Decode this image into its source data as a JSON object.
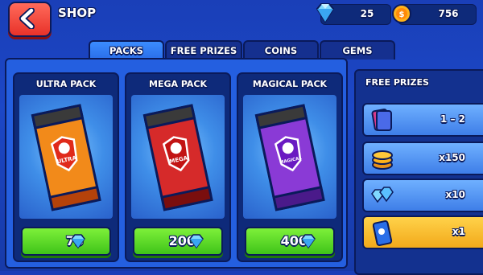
{
  "header": {
    "title": "SHOP",
    "gems": "25",
    "coins": "756"
  },
  "tabs": [
    {
      "label": "PACKS",
      "active": true
    },
    {
      "label": "FREE PRIZES",
      "active": false
    },
    {
      "label": "COINS",
      "active": false
    },
    {
      "label": "GEMS",
      "active": false
    }
  ],
  "packs": [
    {
      "title": "ULTRA PACK",
      "badge": "ULTRA",
      "price": "75",
      "color": "#f28a1a"
    },
    {
      "title": "MEGA PACK",
      "badge": "MEGA",
      "price": "200",
      "color": "#d62a2a"
    },
    {
      "title": "MAGICAL PACK",
      "badge": "MAGICAL",
      "price": "400",
      "color": "#8a3ad6"
    }
  ],
  "free_prizes": {
    "title": "FREE PRIZES",
    "items": [
      {
        "amount": "1 – 2",
        "icon": "cards-icon"
      },
      {
        "amount": "x150",
        "icon": "coins-icon"
      },
      {
        "amount": "x10",
        "icon": "gems-icon"
      },
      {
        "amount": "x1",
        "icon": "pack-icon"
      }
    ]
  }
}
